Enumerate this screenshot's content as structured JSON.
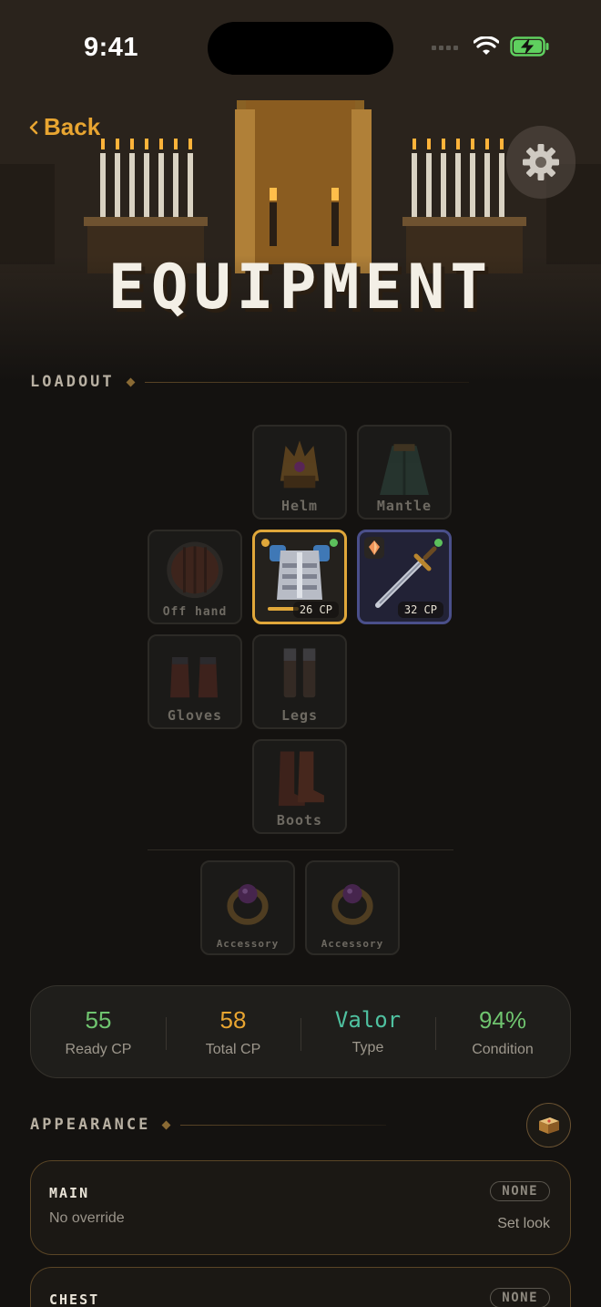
{
  "status_bar": {
    "time": "9:41"
  },
  "header": {
    "back_label": "Back",
    "title": "EQUIPMENT"
  },
  "loadout": {
    "section_label": "LOADOUT",
    "slots": {
      "helm": {
        "label": "Helm"
      },
      "mantle": {
        "label": "Mantle"
      },
      "off_hand": {
        "label": "Off hand"
      },
      "chest": {
        "cp": "26 CP",
        "status": "equipped"
      },
      "main_hand": {
        "cp": "32 CP",
        "status": "equipped"
      },
      "gloves": {
        "label": "Gloves"
      },
      "legs": {
        "label": "Legs"
      },
      "boots": {
        "label": "Boots"
      },
      "accessory_1": {
        "label": "Accessory"
      },
      "accessory_2": {
        "label": "Accessory"
      }
    }
  },
  "stats": [
    {
      "value": "55",
      "label": "Ready CP",
      "color": "#6fc46f"
    },
    {
      "value": "58",
      "label": "Total CP",
      "color": "#e8a531"
    },
    {
      "value": "Valor",
      "label": "Type",
      "color": "#4fc1a0"
    },
    {
      "value": "94%",
      "label": "Condition",
      "color": "#6fc46f"
    }
  ],
  "appearance": {
    "section_label": "APPEARANCE",
    "cards": [
      {
        "title": "MAIN",
        "subtitle": "No override",
        "badge": "NONE",
        "action": "Set look"
      },
      {
        "title": "CHEST",
        "badge": "NONE"
      }
    ]
  },
  "colors": {
    "accent": "#e8a531",
    "gold_border": "#e0a73a",
    "blue_border": "#4a4f8a",
    "ready_dot": "#5cc05c"
  },
  "icons": {
    "back": "chevron-left-icon",
    "settings": "gear-icon",
    "codex": "book-icon"
  }
}
